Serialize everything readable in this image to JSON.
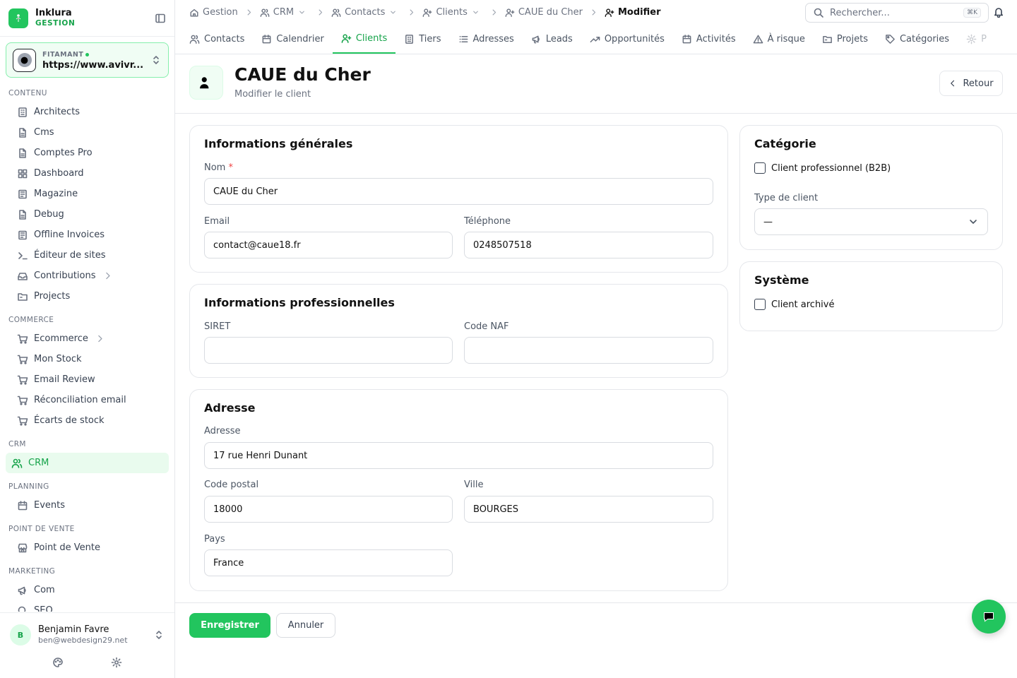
{
  "brand": {
    "name": "Inklura",
    "sub": "GESTION"
  },
  "site": {
    "label": "FITAMANT",
    "url": "https://www.avivr..."
  },
  "sidebar": {
    "sections": [
      {
        "title": "CONTENU",
        "items": [
          {
            "label": "Architects",
            "icon": "building-icon"
          },
          {
            "label": "Cms",
            "icon": "file-icon"
          },
          {
            "label": "Comptes Pro",
            "icon": "file-icon"
          },
          {
            "label": "Dashboard",
            "icon": "grid-icon"
          },
          {
            "label": "Magazine",
            "icon": "newspaper-icon"
          },
          {
            "label": "Debug",
            "icon": "file-icon"
          },
          {
            "label": "Offline Invoices",
            "icon": "newspaper-icon"
          },
          {
            "label": "Éditeur de sites",
            "icon": "terminal-icon"
          },
          {
            "label": "Contributions",
            "icon": "inbox-icon",
            "chevron": true
          },
          {
            "label": "Projects",
            "icon": "folder-icon"
          }
        ]
      },
      {
        "title": "COMMERCE",
        "items": [
          {
            "label": "Ecommerce",
            "icon": "cart-icon",
            "chevron": true
          },
          {
            "label": "Mon Stock",
            "icon": "cart-icon"
          },
          {
            "label": "Email Review",
            "icon": "cart-icon"
          },
          {
            "label": "Réconciliation email",
            "icon": "cart-icon"
          },
          {
            "label": "Écarts de stock",
            "icon": "cart-icon"
          }
        ]
      },
      {
        "title": "CRM",
        "items": [
          {
            "label": "CRM",
            "icon": "users-icon",
            "active": true
          }
        ]
      },
      {
        "title": "PLANNING",
        "items": [
          {
            "label": "Events",
            "icon": "calendar-icon"
          }
        ]
      },
      {
        "title": "POINT DE VENTE",
        "items": [
          {
            "label": "Point de Vente",
            "icon": "store-icon"
          }
        ]
      },
      {
        "title": "MARKETING",
        "items": [
          {
            "label": "Com",
            "icon": "megaphone-icon"
          },
          {
            "label": "SEO",
            "icon": "search-icon"
          }
        ]
      }
    ]
  },
  "user": {
    "initial": "B",
    "name": "Benjamin Favre",
    "email": "ben@webdesign29.net"
  },
  "breadcrumb": [
    {
      "label": "Gestion",
      "icon": "home-icon"
    },
    {
      "label": "CRM",
      "icon": "users-icon",
      "dropdown": true
    },
    {
      "label": "Contacts",
      "icon": "users-icon",
      "dropdown": true
    },
    {
      "label": "Clients",
      "icon": "user-plus-icon",
      "dropdown": true
    },
    {
      "label": "CAUE du Cher",
      "icon": "user-plus-icon"
    },
    {
      "label": "Modifier",
      "icon": "user-plus-icon",
      "current": true
    }
  ],
  "search": {
    "placeholder": "Rechercher...",
    "shortcut": "⌘K"
  },
  "tabs": [
    {
      "label": "Contacts",
      "icon": "users-icon"
    },
    {
      "label": "Calendrier",
      "icon": "calendar-icon"
    },
    {
      "label": "Clients",
      "icon": "user-plus-icon",
      "active": true
    },
    {
      "label": "Tiers",
      "icon": "building-icon"
    },
    {
      "label": "Adresses",
      "icon": "list-icon"
    },
    {
      "label": "Leads",
      "icon": "megaphone-icon"
    },
    {
      "label": "Opportunités",
      "icon": "trend-icon"
    },
    {
      "label": "Activités",
      "icon": "calendar-icon"
    },
    {
      "label": "À risque",
      "icon": "warning-icon"
    },
    {
      "label": "Projets",
      "icon": "folder-icon"
    },
    {
      "label": "Catégories",
      "icon": "tag-icon"
    },
    {
      "label": "P",
      "icon": "gear-icon"
    }
  ],
  "header": {
    "title": "CAUE du Cher",
    "subtitle": "Modifier le client",
    "back_label": "Retour"
  },
  "general": {
    "title": "Informations générales",
    "nom_label": "Nom",
    "required_mark": "*",
    "nom_value": "CAUE du Cher",
    "email_label": "Email",
    "email_value": "contact@caue18.fr",
    "phone_label": "Téléphone",
    "phone_value": "0248507518"
  },
  "pro": {
    "title": "Informations professionnelles",
    "siret_label": "SIRET",
    "siret_value": "",
    "naf_label": "Code NAF",
    "naf_value": ""
  },
  "address": {
    "title": "Adresse",
    "adresse_label": "Adresse",
    "adresse_value": "17 rue Henri Dunant",
    "cp_label": "Code postal",
    "cp_value": "18000",
    "ville_label": "Ville",
    "ville_value": "BOURGES",
    "pays_label": "Pays",
    "pays_value": "France"
  },
  "category": {
    "title": "Catégorie",
    "b2b_label": "Client professionnel (B2B)",
    "b2b_checked": false,
    "type_label": "Type de client",
    "type_value": "—"
  },
  "system": {
    "title": "Système",
    "archived_label": "Client archivé",
    "archived_checked": false
  },
  "footer": {
    "save_label": "Enregistrer",
    "cancel_label": "Annuler"
  },
  "colors": {
    "accent": "#22c55e",
    "accent_dark": "#16a34a",
    "active_bg": "#e9fbee"
  }
}
